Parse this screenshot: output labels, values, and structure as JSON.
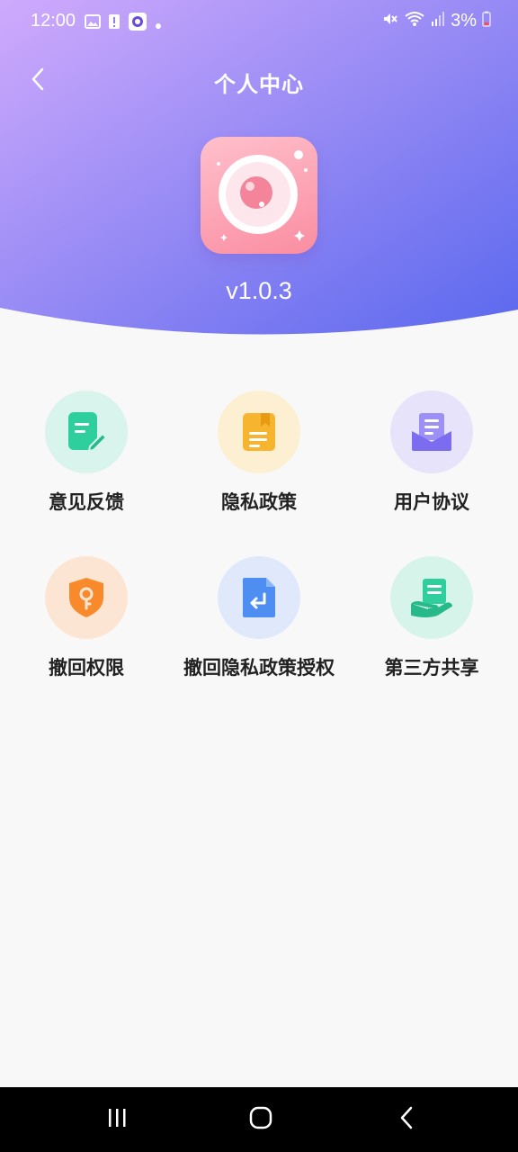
{
  "status_bar": {
    "time": "12:00",
    "battery": "3%"
  },
  "header": {
    "title": "个人中心",
    "version": "v1.0.3"
  },
  "colors": {
    "header_gradient_start": "#c8a8fb",
    "header_gradient_end": "#5e6cef",
    "background": "#f8f8f8",
    "label_color": "#222222"
  },
  "menu": {
    "items": [
      {
        "label": "意见反馈",
        "icon": "feedback-icon",
        "bg": "#d9f4ec",
        "color": "#2fcf9d"
      },
      {
        "label": "隐私政策",
        "icon": "privacy-policy-icon",
        "bg": "#fcefd2",
        "color": "#f7b52f"
      },
      {
        "label": "用户协议",
        "icon": "user-agreement-icon",
        "bg": "#e6e3fb",
        "color": "#7c6df0"
      },
      {
        "label": "撤回权限",
        "icon": "revoke-permission-icon",
        "bg": "#fde5d3",
        "color": "#f88a2c"
      },
      {
        "label": "撤回隐私政策授权",
        "icon": "revoke-privacy-icon",
        "bg": "#dfe9fb",
        "color": "#4e8df2"
      },
      {
        "label": "第三方共享",
        "icon": "third-party-share-icon",
        "bg": "#d7f4ea",
        "color": "#2fcf9d"
      }
    ]
  }
}
